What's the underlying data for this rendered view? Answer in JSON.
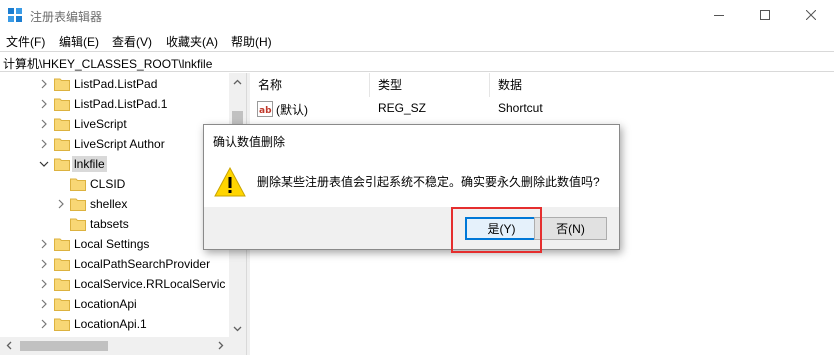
{
  "window": {
    "title": "注册表编辑器"
  },
  "menu": [
    "文件(F)",
    "编辑(E)",
    "查看(V)",
    "收藏夹(A)",
    "帮助(H)"
  ],
  "address": "计算机\\HKEY_CLASSES_ROOT\\lnkfile",
  "tree": [
    {
      "label": "ListPad.ListPad",
      "expander": "collapsed",
      "level": 0
    },
    {
      "label": "ListPad.ListPad.1",
      "expander": "collapsed",
      "level": 0
    },
    {
      "label": "LiveScript",
      "expander": "collapsed",
      "level": 0
    },
    {
      "label": "LiveScript Author",
      "expander": "collapsed",
      "level": 0
    },
    {
      "label": "lnkfile",
      "expander": "expanded",
      "level": 0,
      "selected": true
    },
    {
      "label": "CLSID",
      "expander": "none",
      "level": 1
    },
    {
      "label": "shellex",
      "expander": "collapsed",
      "level": 1
    },
    {
      "label": "tabsets",
      "expander": "none",
      "level": 1
    },
    {
      "label": "Local Settings",
      "expander": "collapsed",
      "level": 0
    },
    {
      "label": "LocalPathSearchProvider",
      "expander": "collapsed",
      "level": 0
    },
    {
      "label": "LocalService.RRLocalServic",
      "expander": "collapsed",
      "level": 0
    },
    {
      "label": "LocationApi",
      "expander": "collapsed",
      "level": 0
    },
    {
      "label": "LocationApi.1",
      "expander": "collapsed",
      "level": 0
    }
  ],
  "list": {
    "columns": [
      "名称",
      "类型",
      "数据"
    ],
    "rows": [
      {
        "name": "(默认)",
        "type": "REG_SZ",
        "data": "Shortcut"
      }
    ]
  },
  "dialog": {
    "title": "确认数值删除",
    "message": "删除某些注册表值会引起系统不稳定。确实要永久删除此数值吗?",
    "yes_label": "是(Y)",
    "no_label": "否(N)"
  },
  "colors": {
    "accent": "#0078d7",
    "highlight_box": "#e52e2e",
    "folder": "#f8d775",
    "warning": "#ffd500"
  }
}
